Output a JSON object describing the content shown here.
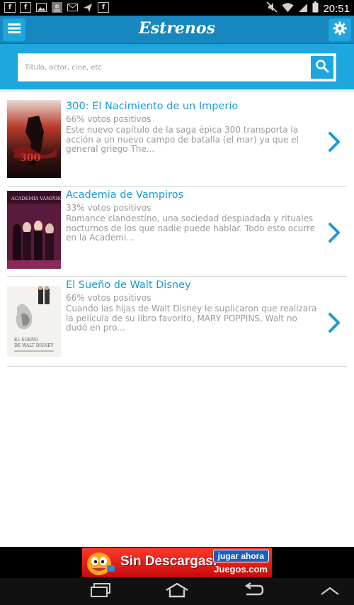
{
  "status_bar": {
    "time": "20:51",
    "icons": [
      "facebook-icon",
      "facebook-icon",
      "gallery-icon",
      "photo-icon",
      "email-icon",
      "send-icon",
      "facebook-icon",
      "mute-icon",
      "wifi-icon",
      "signal-icon",
      "battery-icon"
    ]
  },
  "header": {
    "title": "Estrenos",
    "menu_icon": "menu-icon",
    "settings_icon": "gear-icon"
  },
  "search": {
    "placeholder": "Titulo, actor, cine, etc",
    "value": "",
    "icon": "search-icon"
  },
  "movies": [
    {
      "title": "300: El Nacimiento de un Imperio",
      "votes": "66% votos positivos",
      "description": "Este nuevo capítulo de la saga épica 300 transporta la acción a un nuevo campo de batalla (el mar) ya que el general griego The..."
    },
    {
      "title": "Academia de Vampiros",
      "votes": "33% votos positivos",
      "description": "Romance clandestino, una sociedad despiadada y rituales nocturnos de los que nadie puede hablar. Todo esto ocurre en la Academi..."
    },
    {
      "title": "El Sueño de Walt Disney",
      "votes": "66% votos positivos",
      "description": "Cuando las hijas de Walt Disney le suplicaron que realizara la película de su libro favorito, MARY POPPINS, Walt no dudó en pro..."
    }
  ],
  "ad": {
    "headline": "Sin Descargas.",
    "cta": "jugar ahora",
    "brand": "Juegos.com"
  },
  "navigation": {
    "icons": [
      "recent-apps-icon",
      "home-icon",
      "back-icon",
      "up-chevron-icon"
    ]
  },
  "colors": {
    "header": "#1787c0",
    "accent": "#1ea7df",
    "title_link": "#1a9bd8",
    "muted_text": "#9a9a9a"
  }
}
